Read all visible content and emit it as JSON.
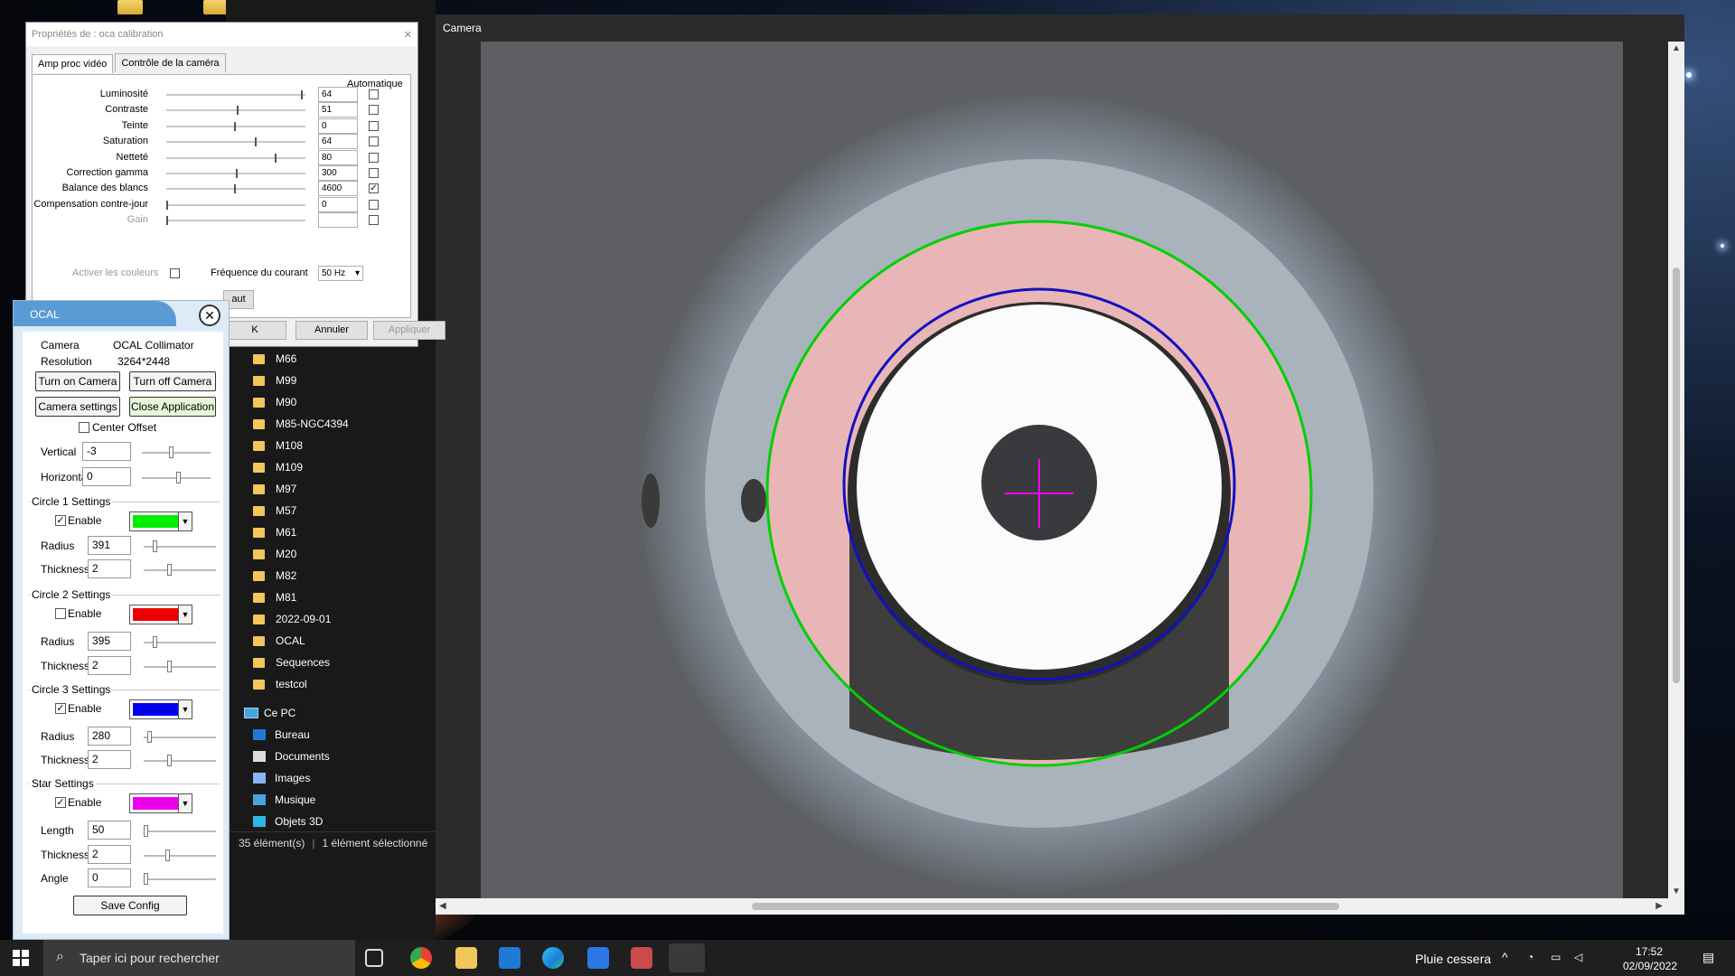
{
  "explorer": {
    "folders": [
      "M66",
      "M99",
      "M90",
      "M85-NGC4394",
      "M108",
      "M109",
      "M97",
      "M57",
      "M61",
      "M20",
      "M82",
      "M81",
      "2022-09-01",
      "OCAL",
      "Sequences",
      "testcol"
    ],
    "pc_label": "Ce PC",
    "pc_items": [
      "Bureau",
      "Documents",
      "Images",
      "Musique",
      "Objets 3D"
    ],
    "status_count": "35 élément(s)",
    "status_selected": "1 élément sélectionné"
  },
  "camera": {
    "title": "Camera",
    "colors": {
      "circle1": "#00d000",
      "circle3": "#1010c0",
      "star": "#ff00ff"
    }
  },
  "props": {
    "title": "Propriétés de : oca calibration",
    "tabs": [
      "Amp proc vidéo",
      "Contrôle de la caméra"
    ],
    "auto_header": "Automatique",
    "rows": [
      {
        "label": "Luminosité",
        "value": "64",
        "level": 0.99,
        "auto": false
      },
      {
        "label": "Contraste",
        "value": "51",
        "level": 0.52,
        "auto": false
      },
      {
        "label": "Teinte",
        "value": "0",
        "level": 0.5,
        "auto": false
      },
      {
        "label": "Saturation",
        "value": "64",
        "level": 0.65,
        "auto": false
      },
      {
        "label": "Netteté",
        "value": "80",
        "level": 0.8,
        "auto": false
      },
      {
        "label": "Correction gamma",
        "value": "300",
        "level": 0.51,
        "auto": false
      },
      {
        "label": "Balance des blancs",
        "value": "4600",
        "level": 0.5,
        "auto": true
      },
      {
        "label": "Compensation contre-jour",
        "value": "0",
        "level": 0.0,
        "auto": false
      },
      {
        "label": "Gain",
        "value": "",
        "level": 0.0,
        "auto": false
      }
    ],
    "colors_label": "Activer les couleurs",
    "freq_label": "Fréquence du courant",
    "freq_value": "50 Hz",
    "default_btn": "aut",
    "ok_btn": "K",
    "cancel_btn": "Annuler",
    "apply_btn": "Appliquer"
  },
  "ocal": {
    "title": "OCAL",
    "camera_label": "Camera",
    "camera_value": "OCAL Collimator",
    "resolution_label": "Resolution",
    "resolution_value": "3264*2448",
    "turn_on": "Turn on Camera",
    "turn_off": "Turn off Camera",
    "settings": "Camera settings",
    "close_app": "Close Application",
    "center_offset": "Center Offset",
    "vertical_label": "Vertical",
    "vertical_value": "-3",
    "horizontal_label": "Horizontal",
    "horizontal_value": "0",
    "enable_label": "Enable",
    "radius_label": "Radius",
    "thickness_label": "Thickness",
    "circle1": {
      "title": "Circle 1 Settings",
      "enabled": true,
      "color": "#00ee00",
      "radius": "391",
      "thickness": "2"
    },
    "circle2": {
      "title": "Circle 2 Settings",
      "enabled": false,
      "color": "#ee0000",
      "radius": "395",
      "thickness": "2"
    },
    "circle3": {
      "title": "Circle 3 Settings",
      "enabled": true,
      "color": "#0000ee",
      "radius": "280",
      "thickness": "2"
    },
    "star": {
      "title": "Star Settings",
      "enabled": true,
      "color": "#ee00ee",
      "length_label": "Length",
      "length": "50",
      "thickness": "2",
      "angle_label": "Angle",
      "angle": "0"
    },
    "save": "Save Config"
  },
  "taskbar": {
    "search_placeholder": "Taper ici pour rechercher",
    "weather": "Pluie cessera",
    "time": "17:52",
    "date": "02/09/2022"
  }
}
